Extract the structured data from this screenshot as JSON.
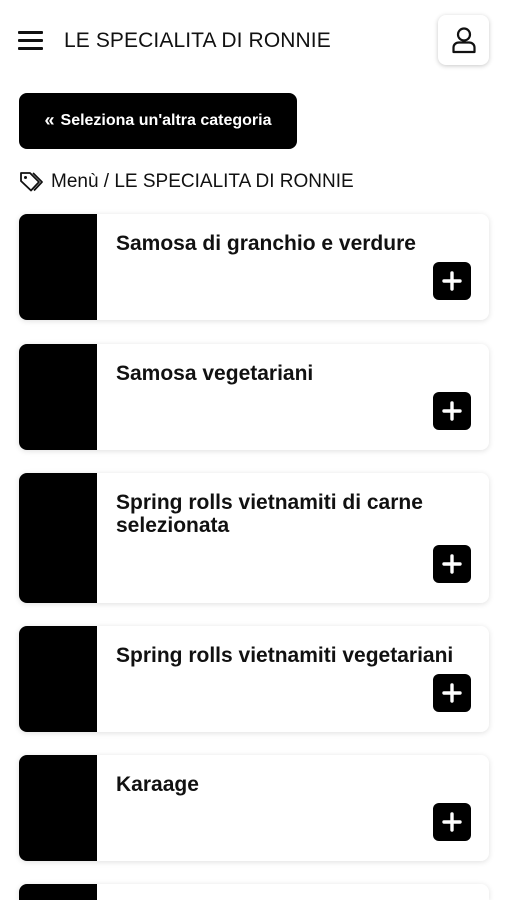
{
  "header": {
    "title": "LE SPECIALITA DI RONNIE",
    "menu_icon": "hamburger-icon",
    "user_icon": "user-icon"
  },
  "back_button": {
    "icon": "double-chevron-left-icon",
    "label": "Seleziona un'altra categoria"
  },
  "breadcrumb": {
    "icon": "tag-icon",
    "text": "Menù / LE SPECIALITA DI RONNIE"
  },
  "products": [
    {
      "name": "Samosa di granchio e verdure"
    },
    {
      "name": "Samosa vegetariani"
    },
    {
      "name": "Spring rolls vietnamiti di carne selezionata"
    },
    {
      "name": "Spring rolls vietnamiti vegetariani"
    },
    {
      "name": "Karaage"
    },
    {
      "name": ""
    }
  ],
  "colors": {
    "accent": "#000000",
    "background": "#ffffff",
    "text": "#111111"
  }
}
